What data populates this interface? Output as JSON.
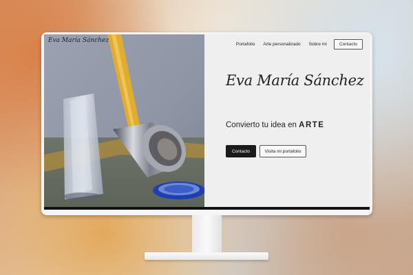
{
  "header": {
    "logo_text": "Eva María Sánchez",
    "nav": {
      "portfolio": "Portafolio",
      "custom_art": "Arte personalizado",
      "about": "Sobre mí",
      "contact": "Contacto"
    }
  },
  "hero": {
    "name": "Eva María Sánchez",
    "tagline_prefix": "Convierto tu idea en",
    "tagline_emphasis": "ARTE",
    "primary_button": "Contacto",
    "secondary_button": "Visita mi portafolio"
  },
  "colors": {
    "dark_button": "#1b1b1b",
    "page_bg": "#efefef",
    "accent_blue": "#1f3fb0"
  }
}
